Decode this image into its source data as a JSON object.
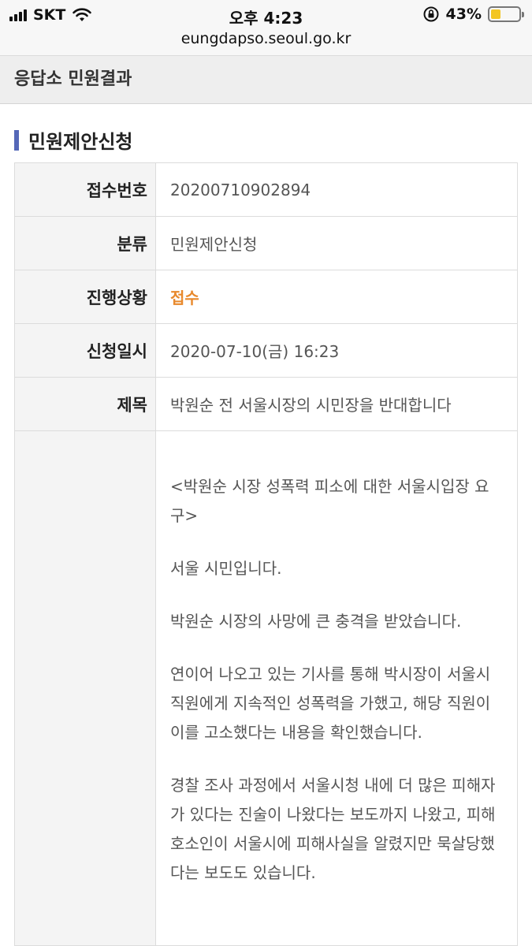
{
  "status_bar": {
    "carrier": "SKT",
    "time": "오후 4:23",
    "battery_percent": "43%",
    "battery_level": 0.43
  },
  "url_bar": {
    "url": "eungdapso.seoul.go.kr"
  },
  "page_header": {
    "title": "응답소 민원결과"
  },
  "section": {
    "title": "민원제안신청"
  },
  "table": {
    "receipt_no": {
      "label": "접수번호",
      "value": "20200710902894"
    },
    "category": {
      "label": "분류",
      "value": "민원제안신청"
    },
    "status": {
      "label": "진행상황",
      "value": "접수"
    },
    "date": {
      "label": "신청일시",
      "value": "2020-07-10(금) 16:23"
    },
    "subject": {
      "label": "제목",
      "value": "박원순 전 서울시장의 시민장을 반대합니다"
    }
  },
  "content": {
    "paragraphs": [
      "<박원순 시장 성폭력 피소에 대한 서울시입장 요구>",
      "서울 시민입니다.",
      "박원순 시장의 사망에 큰 충격을 받았습니다.",
      "연이어 나오고 있는 기사를 통해 박시장이 서울시 직원에게 지속적인 성폭력을 가했고, 해당 직원이 이를 고소했다는 내용을 확인했습니다.",
      "경찰 조사 과정에서 서울시청 내에 더 많은 피해자가 있다는 진술이 나왔다는 보도까지 나왔고, 피해호소인이 서울시에 피해사실을 알렸지만 묵살당했다는 보도도 있습니다."
    ]
  },
  "colors": {
    "accent_bar": "#5568b8",
    "status_orange": "#e8892c",
    "battery_yellow": "#f3c623"
  }
}
